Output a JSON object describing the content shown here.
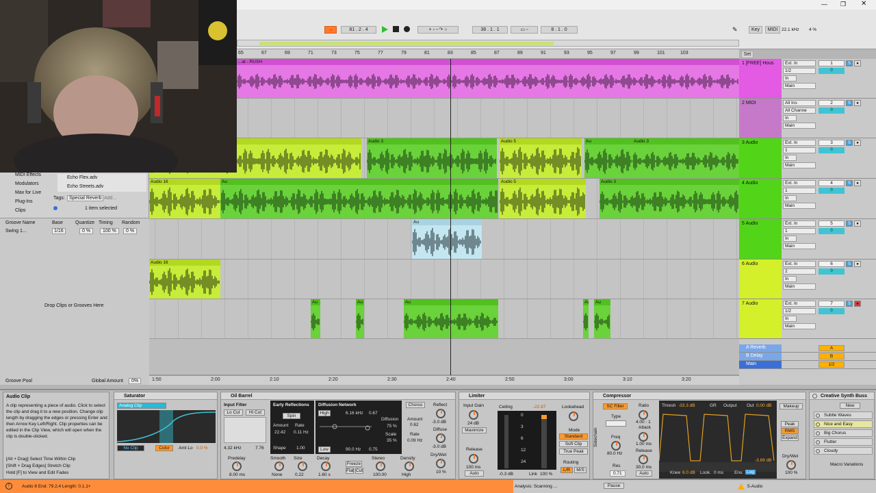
{
  "transport": {
    "arrangement_position": "81 .  2 .  4",
    "loop_start": "38 .  1 .  1",
    "loop_length": "8 .  1 .  0",
    "key_label": "Key",
    "midi_label": "MIDI",
    "sample_rate": "22.1 kHz",
    "cpu": "4 %"
  },
  "ruler": {
    "bars": [
      "65",
      "67",
      "69",
      "71",
      "73",
      "75",
      "77",
      "79",
      "81",
      "83",
      "85",
      "87",
      "89",
      "91",
      "93",
      "95",
      "97",
      "99",
      "101",
      "103"
    ],
    "times": [
      "1:50",
      "2:00",
      "2:10",
      "2:20",
      "2:30",
      "2:40",
      "2:50",
      "3:00",
      "3:10",
      "3:20"
    ],
    "set_label": "Set"
  },
  "tracks": [
    {
      "name": "1 [FREE] Hous",
      "input": "Ext. In",
      "channel": "1/2",
      "output": "Main",
      "number": "1",
      "color": "#e35ae3",
      "clip_label": "...at - RUSH"
    },
    {
      "name": "2 MIDI",
      "input": "All Ins",
      "channel": "All Channe",
      "output": "Main",
      "number": "2",
      "color": "#c679c9",
      "clip_label": ""
    },
    {
      "name": "3 Audio",
      "input": "Ext. In",
      "channel": "1",
      "output": "Main",
      "number": "3",
      "color": "#52d418",
      "clip_label": "Audio 3"
    },
    {
      "name": "4 Audio",
      "input": "Ext. In",
      "channel": "1",
      "output": "Main",
      "number": "4",
      "color": "#52d418",
      "clip_label": "Audio 16"
    },
    {
      "name": "5 Audio",
      "input": "Ext. In",
      "channel": "1",
      "output": "Main",
      "number": "5",
      "color": "#52d418",
      "clip_label": ""
    },
    {
      "name": "6 Audio",
      "input": "Ext. In",
      "channel": "2",
      "output": "Main",
      "number": "6",
      "color": "#d4f02a",
      "clip_label": "Audio 16"
    },
    {
      "name": "7 Audio",
      "input": "Ext. In",
      "channel": "1/2",
      "output": "Main",
      "number": "7",
      "color": "#d4f02a",
      "clip_label": ""
    }
  ],
  "returns": [
    {
      "name": "A Reverb",
      "letter": "A"
    },
    {
      "name": "B Delay",
      "letter": "B"
    },
    {
      "name": "Main",
      "letter": "1/2"
    }
  ],
  "clip_labels": {
    "audio5": "Audio 5",
    "audio3": "Audio 3",
    "audio16": "Audio 16",
    "audio_short": "Au"
  },
  "browser": {
    "items": [
      "MIDI Effects",
      "Modulators",
      "Max for Live",
      "Plug-Ins",
      "Clips"
    ],
    "files": [
      "Echo Flex.adv",
      "Echo Streets.adv"
    ],
    "tags_label": "Tags:",
    "tag": "Special Reverb",
    "add": "Add...",
    "selected": "1 item selected"
  },
  "groove": {
    "headers": [
      "Groove Name",
      "Base",
      "Quantize",
      "Timing",
      "Random"
    ],
    "row": [
      "Swing 1...",
      "1/16",
      "0 %",
      "100 %",
      "0 %"
    ],
    "drop_text": "Drop Clips or Grooves Here",
    "pool_label": "Groove Pool",
    "global_label": "Global Amount",
    "global_value": "0%"
  },
  "info": {
    "title": "Audio Clip",
    "text": "A clip representing a piece of audio. Click to select the clip and drag it to a new position. Change clip length by dragging the edges or pressing Enter and then Arrow Key Left/Right. Clip properties can be edited in the Clip View, which will open when the clip is double-clicked.",
    "hints": [
      "[Alt + Drag] Select Time Within Clip",
      "[Shift + Drag Edges] Stretch Clip",
      "Hold [F] to View and Edit Fades"
    ]
  },
  "saturator": {
    "title": "Saturator",
    "mode": "Analog Clip",
    "no_clip": "No Clip",
    "color": "Color",
    "amt_lo": "Amt Lo",
    "amt_lo_val": "0.0 %",
    "knobs": [
      {
        "l": "Drive",
        "v": "0.0 dB"
      },
      {
        "l": "Output",
        "v": "0.0 dB"
      },
      {
        "l": "Dry/Wet",
        "v": "100 %"
      }
    ]
  },
  "oilbarrel": {
    "title": "Oil Barrel",
    "input_filter": "Input Filter",
    "lo_cut": "Lo Cut",
    "hi_cut": "Hi Cut",
    "freq1": "4.32 kHz",
    "q": "7.76",
    "early": "Early Reflections",
    "spin": "Spin",
    "amount_l": "Amount",
    "rate_l": "Rate",
    "amount_v": "22.42",
    "rate_v": "0.11 Hz",
    "shape_l": "Shape",
    "shape_v": "1.00",
    "diffusion": "Diffusion Network",
    "high": "High",
    "hz": "6.16 kHz",
    "hz_v": "0.67",
    "diff_l": "Diffusion",
    "diff_v": "75 %",
    "scale_l": "Scale",
    "scale_v": "35 %",
    "low": "Low",
    "low_hz": "90.0 Hz",
    "low_v": "0.75",
    "chorus": "Chorus",
    "ch_amount": "Amount",
    "ch_amount_v": "0.62",
    "ch_rate": "Rate",
    "ch_rate_v": "0.09 Hz",
    "bottom": [
      {
        "l": "Predelay",
        "v": "8.00 ms"
      },
      {
        "l": "Smooth",
        "v": "None"
      },
      {
        "l": "Size",
        "v": "0.22"
      },
      {
        "l": "Decay",
        "v": "1.60 s"
      },
      {
        "l": "Freeze",
        "v": ""
      },
      {
        "l": "Stereo",
        "v": "100.00"
      },
      {
        "l": "Density",
        "v": "High"
      }
    ],
    "flat": "Flat",
    "cut": "Cut",
    "reflect": "Reflect",
    "reflect_v": "-3.0 dB",
    "diffuse": "Diffuse",
    "diffuse_v": "-3.0 dB",
    "drywet": "Dry/Wet",
    "drywet_v": "10 %"
  },
  "limiter": {
    "title": "Limiter",
    "input_gain": "Input Gain",
    "ig_v": "24 dB",
    "maximize": "Maximize",
    "release": "Release",
    "rel_v": "100 ms",
    "auto": "Auto",
    "ceiling": "Ceiling",
    "ceil_v": "-0.3 dB",
    "peak_v": "-22.87",
    "link": "Link",
    "link_v": "100 %",
    "lookahead": "Lookahead",
    "mode": "Mode",
    "standard": "Standard",
    "soft_clip": "Soft Clip",
    "true_peak": "True Peak",
    "routing": "Routing",
    "lr": "L/R",
    "ms": "M/S",
    "scale": [
      "0",
      "3",
      "6",
      "12",
      "24"
    ]
  },
  "compressor": {
    "title": "Compressor",
    "sc_filter": "SC Filter",
    "type": "Type",
    "freq": "Freq",
    "freq_v": "80.0 Hz",
    "res": "Res",
    "res_v": "0.71",
    "ratio": "Ratio",
    "ratio_v": "4.00 : 1",
    "attack": "Attack",
    "attack_v": "1.00 ms",
    "release": "Release",
    "release_v": "30.0 ms",
    "auto": "Auto",
    "thresh": "Thresh",
    "thresh_v": "-33.3 dB",
    "gr": "GR",
    "output": "Output",
    "out": "Out",
    "out_v": "0.00 dB",
    "gr_v": "-3.89 dB",
    "knee": "Knee",
    "knee_v": "6.0 dB",
    "look": "Look.",
    "look_v": "0 ms",
    "env": "Env.",
    "env_v": "Log",
    "makeup": "Makeup",
    "peak": "Peak",
    "rms": "RMS",
    "expand": "Expand",
    "drywet": "Dry/Wet",
    "drywet_v": "100 %",
    "sidechain": "Sidechain"
  },
  "synthbus": {
    "title": "Creative Synth Buss",
    "new": "New",
    "items": [
      "Subtle Waves",
      "Nice and Easy",
      "Big Chorus",
      "Flutter",
      "Cloudy"
    ],
    "macro": "Macro Variations"
  },
  "status": {
    "left": "Audio 8  End: 79.2.4  Length: 0.1.1+",
    "analysis": "Analysis: Scanning ...",
    "pause": "Pause",
    "track": "5-Audio"
  },
  "colors": {
    "pink": "#e35ae3",
    "green": "#52d418",
    "lime": "#d4f02a",
    "orange": "#ff7a2a",
    "cyan": "#40c4d4"
  }
}
